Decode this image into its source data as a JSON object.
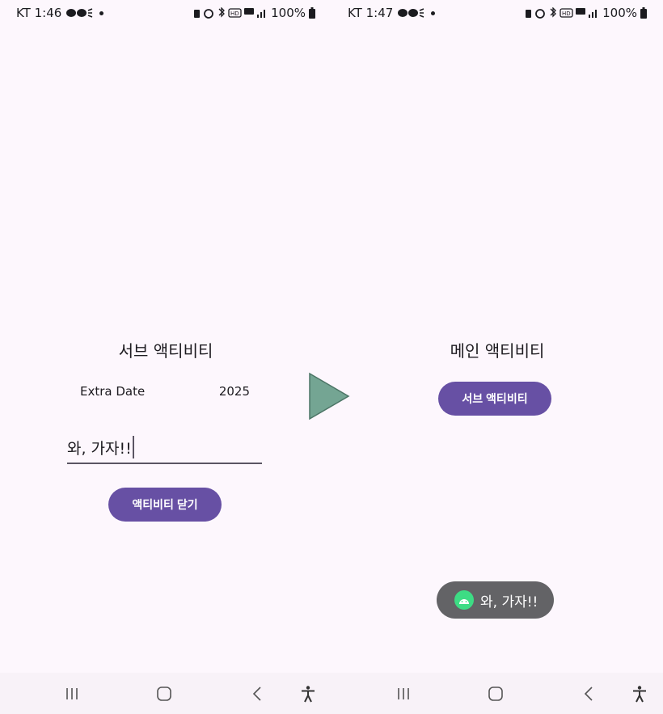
{
  "left_screen": {
    "status": {
      "carrier_time": "KT 1:46",
      "battery": "100%"
    },
    "title": "서브 액티비티",
    "extra_label": "Extra Date",
    "extra_value": "2025",
    "input_value": "와, 가자!!",
    "close_button_label": "액티비티 닫기"
  },
  "right_screen": {
    "status": {
      "carrier_time": "KT 1:47",
      "battery": "100%"
    },
    "title": "메인 액티비티",
    "sub_button_label": "서브 액티비티",
    "toast_text": "와, 가자!!"
  },
  "colors": {
    "background": "#fdf7fd",
    "primary_button": "#6750a4",
    "toast": "#636366",
    "arrow": "#74a593"
  },
  "icons": {
    "nav": [
      "recents-icon",
      "home-icon",
      "back-icon",
      "accessibility-icon"
    ],
    "status": [
      "message-icon",
      "signal-bars-icon",
      "battery-icon",
      "alarm-icon",
      "bluetooth-icon",
      "hd-icon",
      "5g-icon"
    ],
    "toast": "android-icon",
    "transition": "play-arrow-icon"
  }
}
